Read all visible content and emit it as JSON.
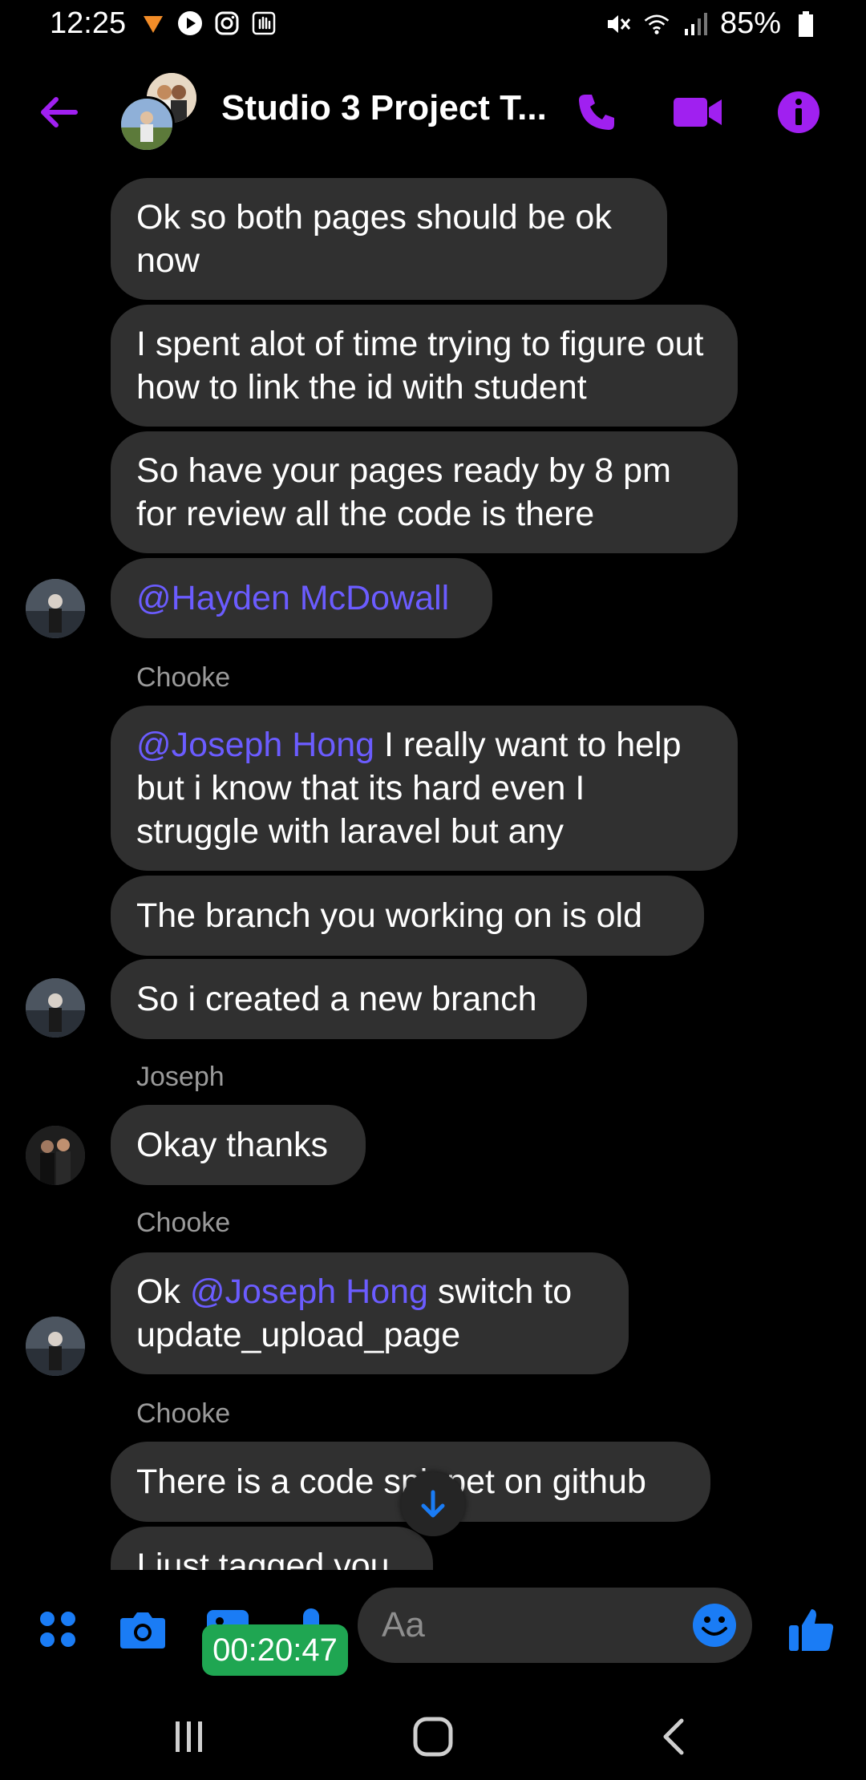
{
  "status_bar": {
    "time": "12:25",
    "battery": "85%",
    "left_icons": [
      "app-notification-icon",
      "play-icon",
      "instagram-icon",
      "hand-icon"
    ],
    "right_icons": [
      "mute-icon",
      "wifi-icon",
      "signal-icon",
      "battery-icon"
    ]
  },
  "header": {
    "title": "Studio 3 Project T...",
    "accent_color": "#a020f0"
  },
  "messages": [
    {
      "type": "bubble",
      "text": "Ok so both pages should be ok now"
    },
    {
      "type": "bubble",
      "text": "I spent alot of time trying to figure out how to link the id with student"
    },
    {
      "type": "bubble",
      "text": "So have your pages ready by 8 pm for review all the code is there"
    },
    {
      "type": "bubble",
      "mention": "@Hayden McDowall"
    },
    {
      "type": "sender",
      "text": "Chooke"
    },
    {
      "type": "bubble",
      "mention": "@Joseph Hong",
      "text": " I really want to help but i know that its hard even I struggle with laravel but any"
    },
    {
      "type": "bubble",
      "text": "The branch you working on is old"
    },
    {
      "type": "bubble",
      "text": "So i created a new branch"
    },
    {
      "type": "sender",
      "text": "Joseph"
    },
    {
      "type": "bubble",
      "text": "Okay thanks"
    },
    {
      "type": "sender",
      "text": "Chooke"
    },
    {
      "type": "bubble",
      "prefix": "Ok ",
      "mention": "@Joseph Hong",
      "text": " switch to update_upload_page"
    },
    {
      "type": "sender",
      "text": "Chooke"
    },
    {
      "type": "bubble",
      "text": "There is a code snippet on github"
    },
    {
      "type": "bubble",
      "text": "I just tagged you"
    }
  ],
  "composer": {
    "placeholder": "Aa",
    "accent_color": "#1a7cf5"
  },
  "timer": "00:20:47",
  "colors": {
    "mention": "#6b5cff",
    "bubble": "#303030",
    "sender": "#9a9a9a",
    "timer": "#1fa652"
  }
}
